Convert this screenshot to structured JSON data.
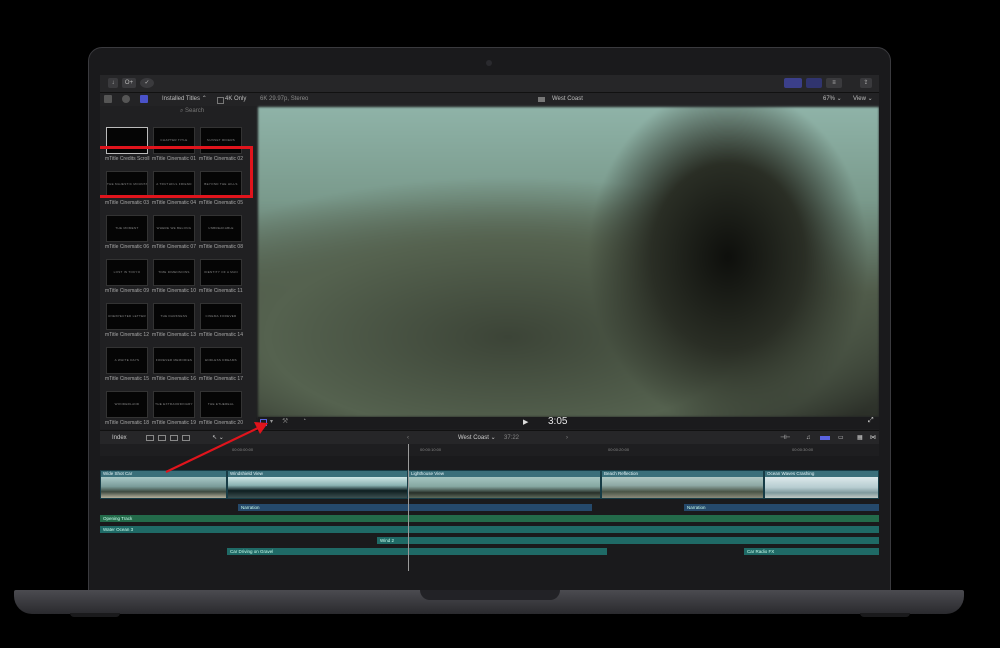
{
  "toolbar": {
    "key_label": "O+",
    "share_label": "⇪"
  },
  "browser": {
    "category": "Installed Titles",
    "filter_label": "4K Only",
    "search_placeholder": "Search",
    "items": [
      {
        "thumb": "",
        "label": "mTitle Credits Scroll"
      },
      {
        "thumb": "CHAPTER TITLE",
        "label": "mTitle Cinematic 01"
      },
      {
        "thumb": "SUNSET RIDERS",
        "label": "mTitle Cinematic 02"
      },
      {
        "thumb": "THE MAJESTIC MOUNTAINS",
        "label": "mTitle Cinematic 03"
      },
      {
        "thumb": "A TRUTHFUL FRIEND",
        "label": "mTitle Cinematic 04"
      },
      {
        "thumb": "BEYOND THE HILLS",
        "label": "mTitle Cinematic 05"
      },
      {
        "thumb": "THE MOMENT",
        "label": "mTitle Cinematic 06"
      },
      {
        "thumb": "WHERE WE BELONG",
        "label": "mTitle Cinematic 07"
      },
      {
        "thumb": "UNBREAKABLE",
        "label": "mTitle Cinematic 08"
      },
      {
        "thumb": "LOST IN TOKYO",
        "label": "mTitle Cinematic 09"
      },
      {
        "thumb": "TIME DIMENSIONS",
        "label": "mTitle Cinematic 10"
      },
      {
        "thumb": "IDENTITY OF A MAN",
        "label": "mTitle Cinematic 11"
      },
      {
        "thumb": "UNEXPECTED LETTER",
        "label": "mTitle Cinematic 12"
      },
      {
        "thumb": "THE DARKNESS",
        "label": "mTitle Cinematic 13"
      },
      {
        "thumb": "CINEMA FOREVER",
        "label": "mTitle Cinematic 14"
      },
      {
        "thumb": "A WHITE DAYS",
        "label": "mTitle Cinematic 15"
      },
      {
        "thumb": "FOREVER MEMORIES",
        "label": "mTitle Cinematic 16"
      },
      {
        "thumb": "ENDLESS DREAMS",
        "label": "mTitle Cinematic 17"
      },
      {
        "thumb": "WONDERLAND",
        "label": "mTitle Cinematic 18"
      },
      {
        "thumb": "THE EXTRAORDINARY",
        "label": "mTitle Cinematic 19"
      },
      {
        "thumb": "THE ETHEREAL",
        "label": "mTitle Cinematic 20"
      }
    ]
  },
  "viewer": {
    "format": "6K 29.97p, Stereo",
    "title": "West Coast",
    "zoom": "67%",
    "view_label": "View",
    "timecode": "3:05"
  },
  "timeline": {
    "index_label": "Index",
    "project": "West Coast",
    "duration": "37:22",
    "ruler": [
      "00:00:00:00",
      "00:00:10:00",
      "00:00:20:00",
      "00:00:30:00"
    ],
    "clips": [
      {
        "name": "Wide Shot Car"
      },
      {
        "name": "Windshield View"
      },
      {
        "name": "Lighthouse View"
      },
      {
        "name": "Beach Reflection"
      },
      {
        "name": "Ocean Waves Crashing"
      }
    ],
    "narration_1": "Narration",
    "narration_2": "Narration",
    "audio_1": "Opening Track",
    "audio_2": "Water Ocean 3",
    "audio_3": "Wind 2",
    "audio_4": "Car Driving on Gravel",
    "audio_5": "Car Radio FX"
  },
  "colors": {
    "highlight": "#e0141c",
    "clip": "#3a6f7a",
    "narration": "#25496b",
    "music": "#236b4a"
  }
}
